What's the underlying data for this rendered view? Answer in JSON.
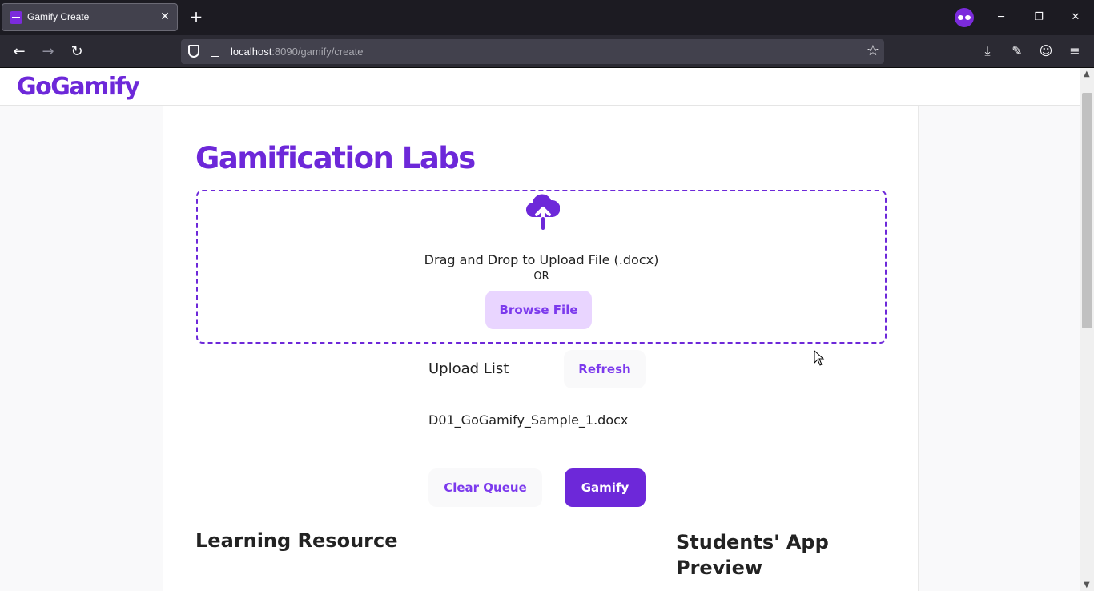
{
  "browser": {
    "tab_title": "Gamify Create",
    "tab_close": "✕",
    "new_tab": "+",
    "url_host": "localhost",
    "url_path": ":8090/gamify/create"
  },
  "site": {
    "logo": "GoGamify"
  },
  "main": {
    "title": "Gamification Labs",
    "dropzone": {
      "instruction": "Drag and Drop to Upload File (.docx)",
      "or": "OR",
      "browse_label": "Browse File"
    },
    "upload_list": {
      "label": "Upload List",
      "refresh_label": "Refresh",
      "files": [
        "D01_GoGamify_Sample_1.docx"
      ]
    },
    "actions": {
      "clear_label": "Clear Queue",
      "gamify_label": "Gamify"
    },
    "sections": {
      "learning_resource": "Learning Resource",
      "students_preview": "Students' App Preview"
    }
  },
  "colors": {
    "brand": "#6d28d9",
    "browse_bg": "#e9d5ff"
  }
}
